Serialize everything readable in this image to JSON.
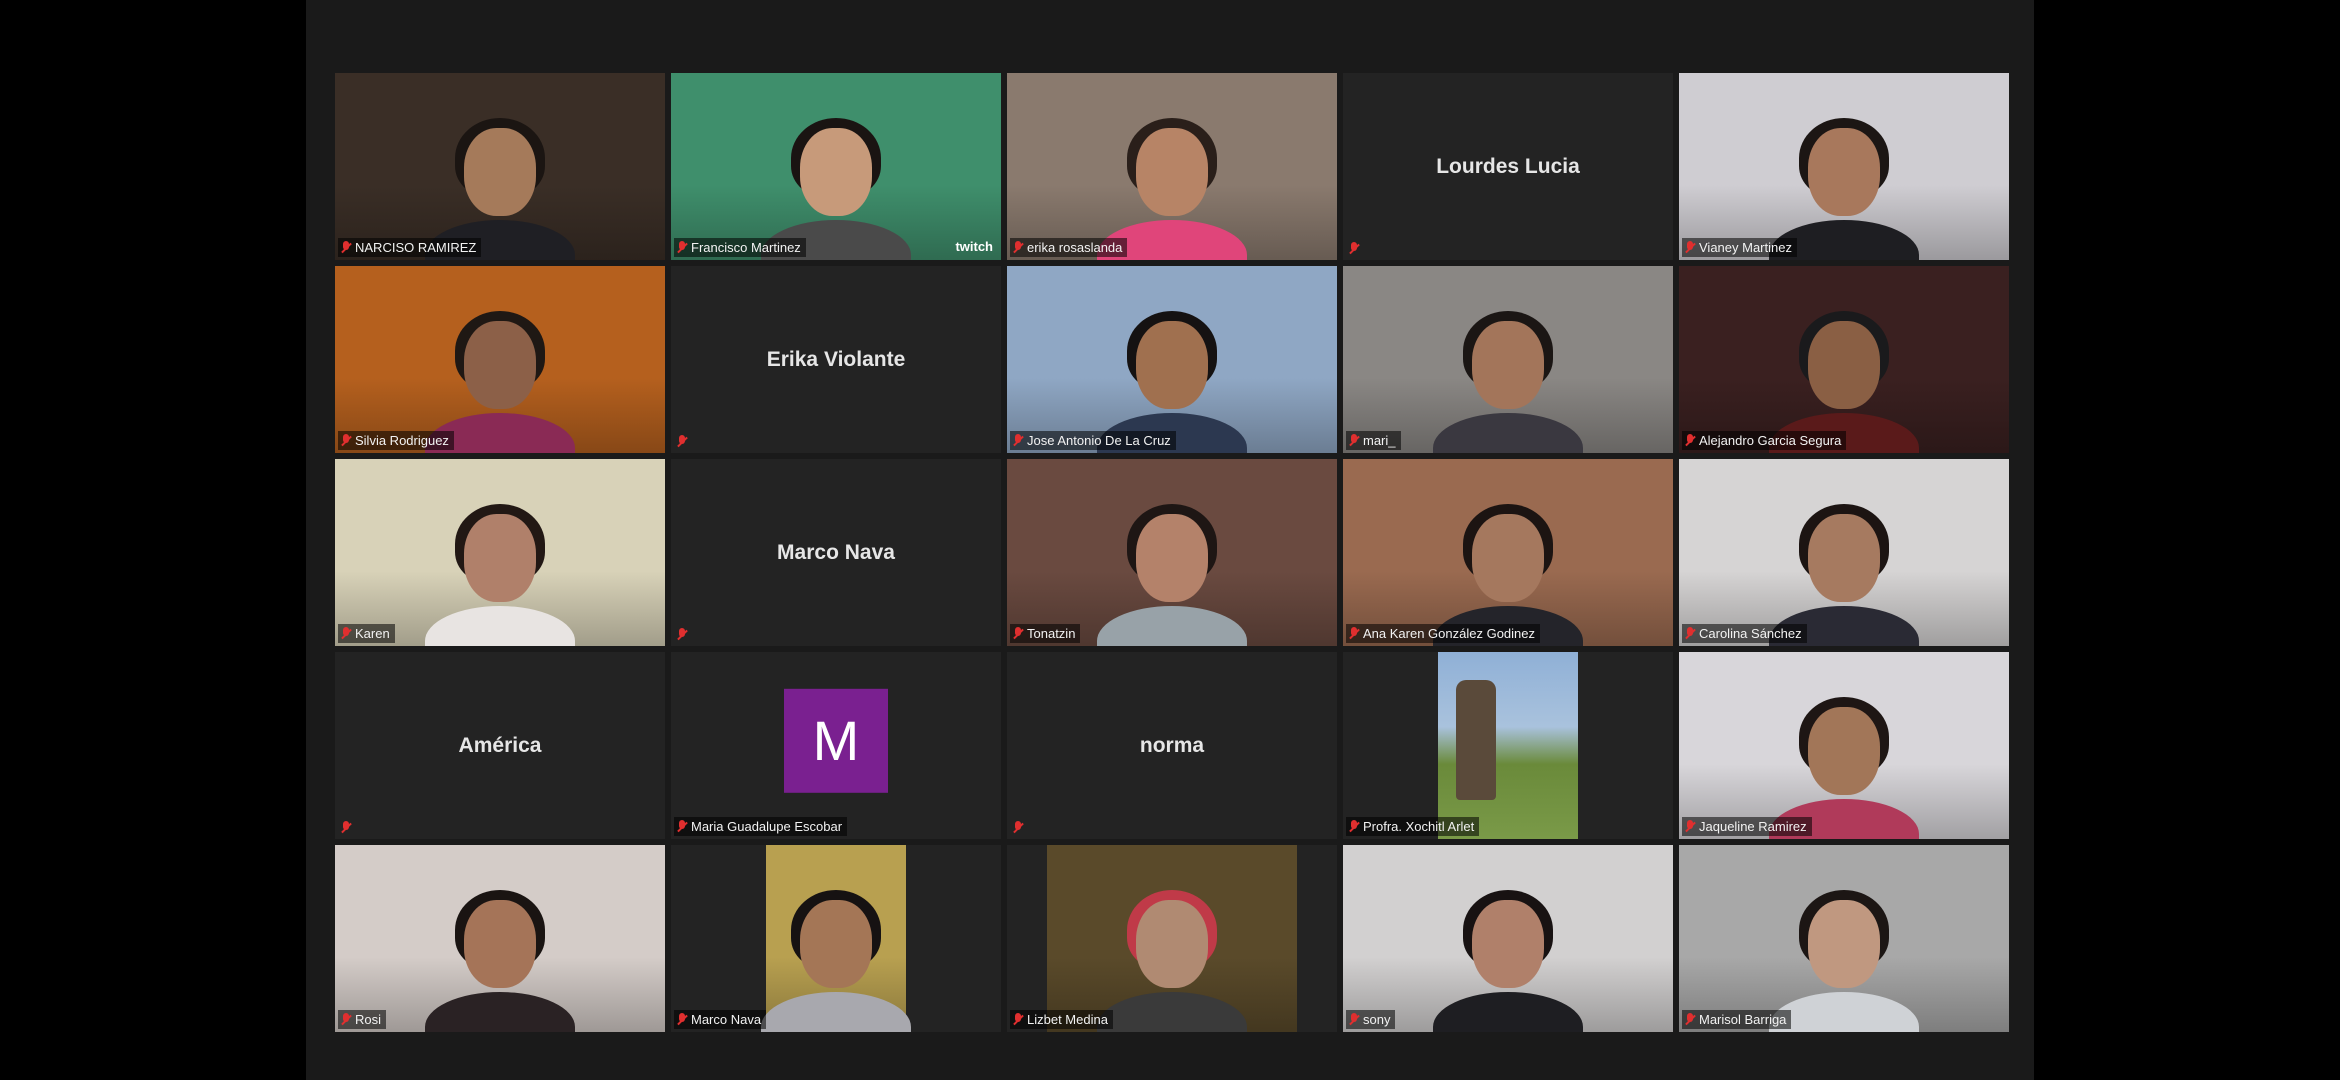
{
  "participants": [
    {
      "name": "NARCISO RAMIREZ",
      "video": true,
      "bg": "#3a2e26",
      "skin": "#a57a5a",
      "hair": "#1b1512",
      "shirt": "#1f1f24"
    },
    {
      "name": "Francisco Martinez",
      "video": true,
      "active": true,
      "bg": "#3f8f6c",
      "skin": "#c79a7a",
      "hair": "#1a1412",
      "shirt": "#4a4a4a",
      "overlay_text": "twitch"
    },
    {
      "name": "erika rosaslanda",
      "video": true,
      "bg": "#8a7a6e",
      "skin": "#b78466",
      "hair": "#2a1f1a",
      "shirt": "#e0457a"
    },
    {
      "name": "Lourdes Lucia",
      "video": false
    },
    {
      "name": "Vianey Martinez",
      "video": true,
      "bg": "#cfcdd2",
      "skin": "#a8785c",
      "hair": "#1c1614",
      "shirt": "#1e1e22"
    },
    {
      "name": "Silvia Rodriguez",
      "video": true,
      "bg": "#b5601e",
      "skin": "#8c6048",
      "hair": "#1f1814",
      "shirt": "#8a2a55"
    },
    {
      "name": "Erika Violante",
      "video": false
    },
    {
      "name": "Jose Antonio De La Cruz",
      "video": true,
      "bg": "#8fa7c4",
      "skin": "#a0704f",
      "hair": "#151212",
      "shirt": "#2c3850"
    },
    {
      "name": "mari_",
      "video": true,
      "bg": "#8a8784",
      "skin": "#a3755a",
      "hair": "#1b1614",
      "shirt": "#3a3840"
    },
    {
      "name": "Alejandro Garcia Segura",
      "video": true,
      "bg": "#3a2020",
      "skin": "#8a5f44",
      "hair": "#1a1a1c",
      "shirt": "#5a1a1a"
    },
    {
      "name": "Karen",
      "video": true,
      "bg": "#d8d2b8",
      "skin": "#b0806a",
      "hair": "#221814",
      "shirt": "#e8e4e2"
    },
    {
      "name": "Marco Nava",
      "video": false
    },
    {
      "name": "Tonatzin",
      "video": true,
      "bg": "#6a4a40",
      "skin": "#b4826a",
      "hair": "#1e1614",
      "shirt": "#98a2a8"
    },
    {
      "name": "Ana Karen González Godinez",
      "video": true,
      "bg": "#9a6a50",
      "skin": "#a5785e",
      "hair": "#1c1412",
      "shirt": "#24242a"
    },
    {
      "name": "Carolina Sánchez",
      "video": true,
      "bg": "#d6d4d4",
      "skin": "#a67a60",
      "hair": "#1c1412",
      "shirt": "#2a2a34"
    },
    {
      "name": "América",
      "video": false,
      "center_name": true,
      "show_label": false
    },
    {
      "name": "Maria Guadalupe Escobar",
      "video": false,
      "avatar_letter": "M"
    },
    {
      "name": "norma",
      "video": false,
      "center_name": true,
      "show_label": false
    },
    {
      "name": "Profra. Xochitl Arlet",
      "video": false,
      "picture": "moai"
    },
    {
      "name": "Jaqueline Ramirez",
      "video": true,
      "bg": "#d8d6da",
      "skin": "#a27658",
      "hair": "#1e1614",
      "shirt": "#b03a5a"
    },
    {
      "name": "Rosi",
      "video": true,
      "bg": "#d4ccc8",
      "skin": "#a57458",
      "hair": "#1a1412",
      "shirt": "#2a2224"
    },
    {
      "name": "Marco Nava",
      "video": true,
      "inset": true,
      "bg": "#b8a050",
      "skin": "#a47656",
      "hair": "#161212",
      "shirt": "#a8a8ae"
    },
    {
      "name": "Lizbet Medina",
      "video": true,
      "inset": true,
      "bg": "#5a4a2a",
      "skin": "#b08a72",
      "hair": "#c03a48",
      "shirt": "#3a3a3a"
    },
    {
      "name": "sony",
      "video": true,
      "bg": "#d2d0d0",
      "skin": "#b0806a",
      "hair": "#181212",
      "shirt": "#1e1e22"
    },
    {
      "name": "Marisol Barriga",
      "video": true,
      "bg": "#a8a8a8",
      "skin": "#c09880",
      "hair": "#1c1614",
      "shirt": "#cfd2d6"
    }
  ],
  "named_tiles": {
    "lourdes": "Lourdes Lucia",
    "erika_v": "Erika Violante",
    "marco": "Marco Nava",
    "america": "América",
    "norma": "norma"
  }
}
